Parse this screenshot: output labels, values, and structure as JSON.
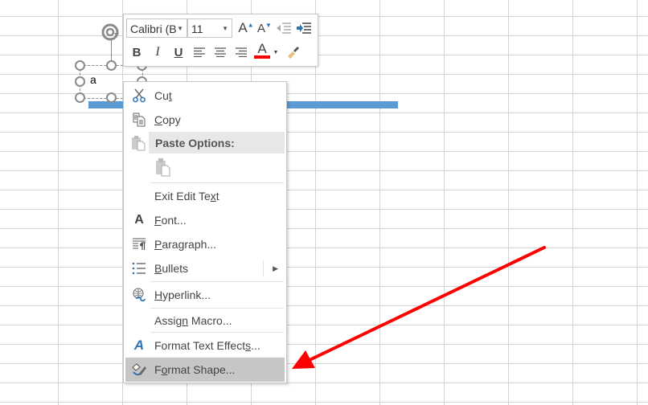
{
  "textbox": {
    "text": "a"
  },
  "mini_toolbar": {
    "font_name": "Calibri (B",
    "font_size": "11",
    "buttons": [
      {
        "name": "increase-font-size",
        "glyph": "A"
      },
      {
        "name": "decrease-font-size",
        "glyph": "A"
      },
      {
        "name": "decrease-indent",
        "glyph": "⇤"
      },
      {
        "name": "increase-indent",
        "glyph": "⇥"
      },
      {
        "name": "bold",
        "glyph": "B"
      },
      {
        "name": "italic",
        "glyph": "I"
      },
      {
        "name": "underline",
        "glyph": "U"
      },
      {
        "name": "align-left",
        "glyph": "≡"
      },
      {
        "name": "align-center",
        "glyph": "≡"
      },
      {
        "name": "align-right",
        "glyph": "≡"
      },
      {
        "name": "font-color",
        "glyph": "A"
      },
      {
        "name": "format-painter",
        "glyph": "🖌"
      }
    ],
    "font_color": "#ff0000"
  },
  "context_menu": {
    "items": [
      {
        "label_pre": "Cu",
        "label_u": "t",
        "label_post": "",
        "icon": "scissors-icon"
      },
      {
        "label_pre": "",
        "label_u": "C",
        "label_post": "opy",
        "icon": "copy-icon"
      },
      {
        "label": "Paste Options:",
        "icon": "paste-icon",
        "type": "header"
      },
      {
        "label": "",
        "icon": "paste-option-icon",
        "type": "paste-option"
      },
      {
        "label_pre": "Exit Edit Te",
        "label_u": "x",
        "label_post": "t",
        "icon": ""
      },
      {
        "label_pre": "",
        "label_u": "F",
        "label_post": "ont...",
        "icon": "font-icon"
      },
      {
        "label_pre": "",
        "label_u": "P",
        "label_post": "aragraph...",
        "icon": "paragraph-icon"
      },
      {
        "label_pre": "",
        "label_u": "B",
        "label_post": "ullets",
        "icon": "bullets-icon",
        "submenu": true
      },
      {
        "label_pre": "",
        "label_u": "H",
        "label_post": "yperlink...",
        "icon": "hyperlink-icon"
      },
      {
        "label_pre": "Assig",
        "label_u": "n",
        "label_post": " Macro...",
        "icon": ""
      },
      {
        "label_pre": "Format Text Effect",
        "label_u": "s",
        "label_post": "...",
        "icon": "text-effects-icon"
      },
      {
        "label_pre": "F",
        "label_u": "o",
        "label_post": "rmat Shape...",
        "icon": "format-shape-icon",
        "highlighted": true
      }
    ]
  },
  "annotation": {
    "color": "#ff0000",
    "description": "red arrow pointing to Format Shape..."
  },
  "colors": {
    "shape_line": "#5b9bd5",
    "highlight": "#c6c6c6",
    "grid": "#d4d4d4"
  }
}
